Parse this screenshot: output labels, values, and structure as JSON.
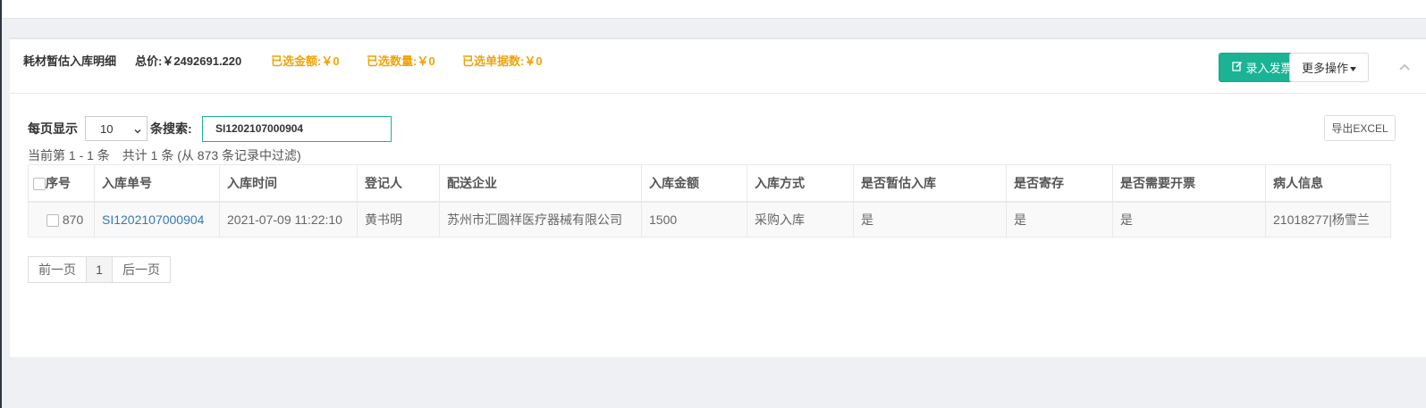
{
  "panel": {
    "title": "耗材暂估入库明细",
    "total_price": "总价:￥2492691.220",
    "selected_amount": "已选金额:￥0",
    "selected_quantity": "已选数量:￥0",
    "selected_docs": "已选单据数:￥0",
    "invoice_button": "录入发票",
    "more_button": "更多操作",
    "export_button": "导出EXCEL"
  },
  "controls": {
    "per_page_label": "每页显示",
    "per_page_value": "10",
    "search_label": "条搜索:",
    "search_value": "SI1202107000904",
    "info": "当前第 1 - 1 条　共计 1 条 (从 873 条记录中过滤)"
  },
  "table": {
    "headers": [
      "序号",
      "入库单号",
      "入库时间",
      "登记人",
      "配送企业",
      "入库金额",
      "入库方式",
      "是否暂估入库",
      "是否寄存",
      "是否需要开票",
      "病人信息"
    ],
    "rows": [
      {
        "index": "870",
        "doc_no": "SI1202107000904",
        "time": "2021-07-09 11:22:10",
        "registrar": "黄书明",
        "supplier": "苏州市汇圆祥医疗器械有限公司",
        "amount": "1500",
        "method": "采购入库",
        "provisional": "是",
        "consigned": "是",
        "needs_invoice": "是",
        "patient": "21018277|杨雪兰"
      }
    ]
  },
  "pagination": {
    "prev": "前一页",
    "current": "1",
    "next": "后一页"
  },
  "icons": {
    "edit": "edit-icon",
    "caret": "caret-down-icon",
    "collapse": "chevron-up-icon"
  },
  "colors": {
    "accent": "#1ab394",
    "highlight": "#f0a30a",
    "link": "#337ab7"
  }
}
